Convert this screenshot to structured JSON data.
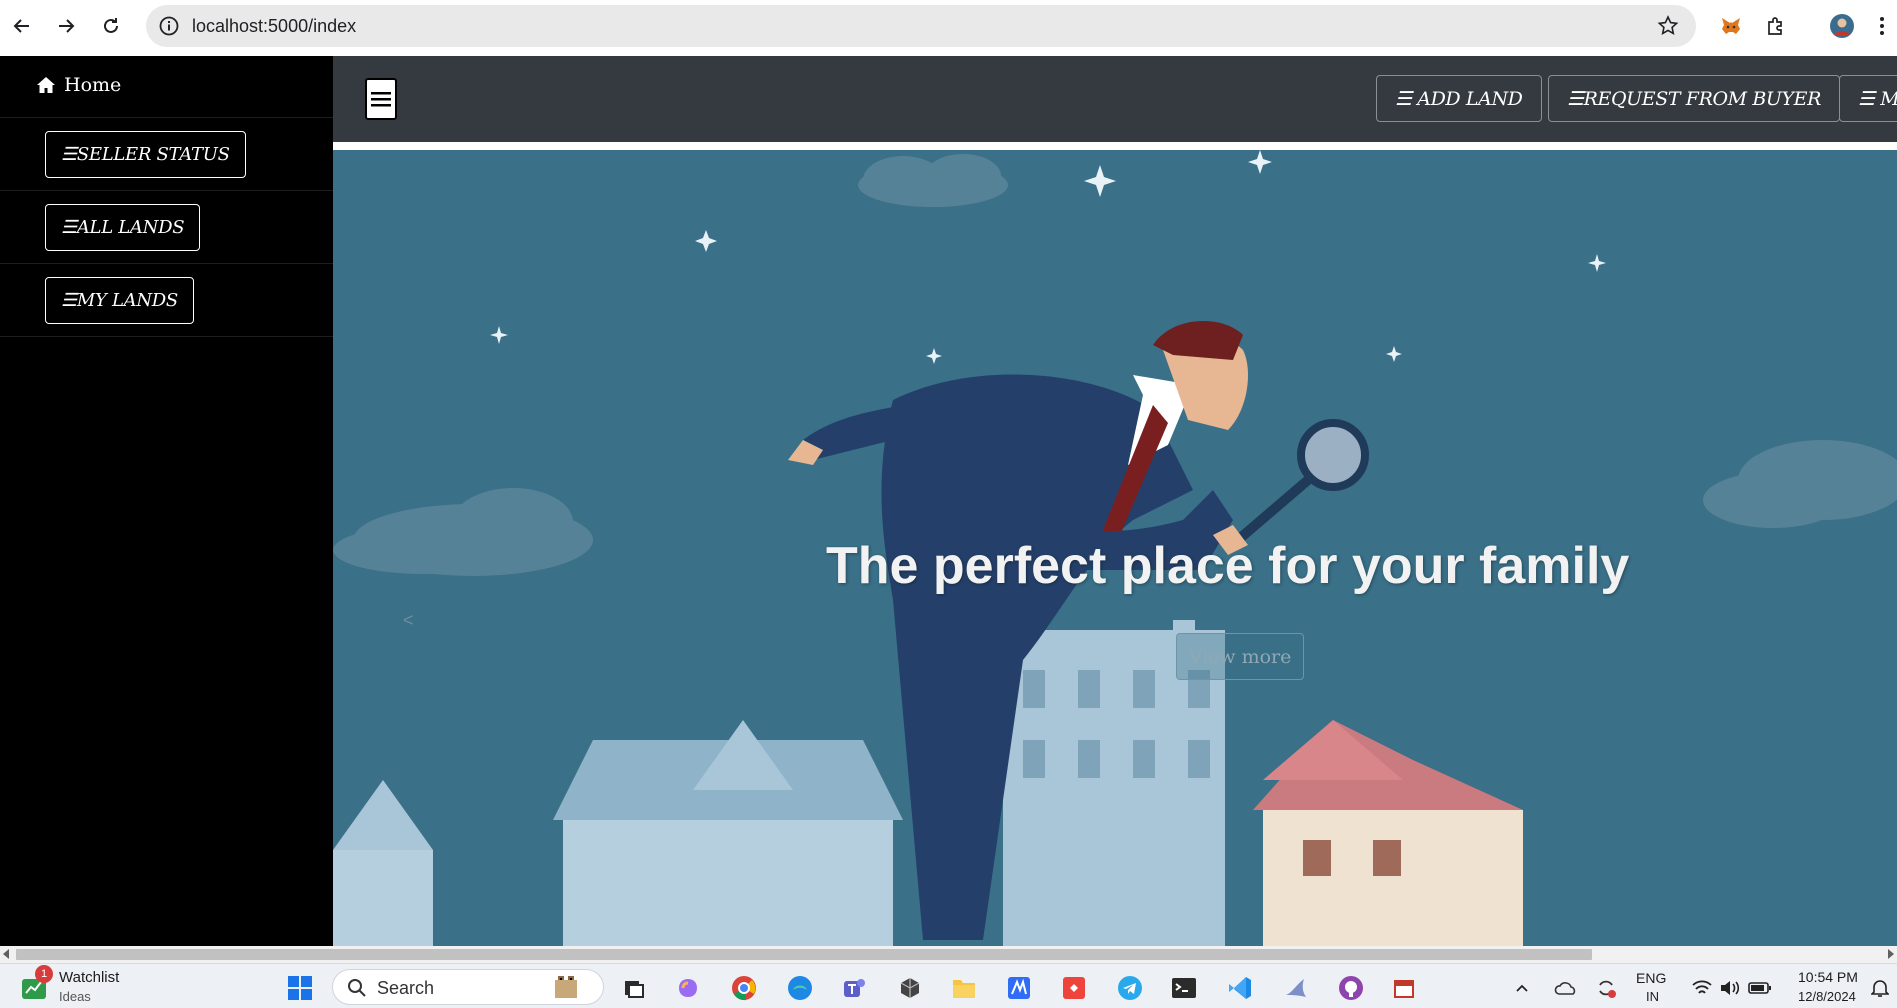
{
  "browser": {
    "url": "localhost:5000/index"
  },
  "sidebar": {
    "home_label": "Home",
    "items": [
      {
        "label": "☰SELLER STATUS"
      },
      {
        "label": "☰ALL LANDS"
      },
      {
        "label": "☰MY LANDS"
      }
    ]
  },
  "topnav": {
    "buttons": [
      {
        "label": "☰ ADD LAND"
      },
      {
        "label": "☰REQUEST FROM BUYER"
      },
      {
        "label": "☰ M"
      }
    ]
  },
  "hero": {
    "title": "The perfect place for your family",
    "button_label": "View more",
    "prev_arrow": "<"
  },
  "taskbar": {
    "widget_title": "Watchlist",
    "widget_subtitle": "Ideas",
    "widget_badge": "1",
    "search_placeholder": "Search",
    "language_top": "ENG",
    "language_bottom": "IN",
    "time": "10:54 PM",
    "date": "12/8/2024"
  },
  "colors": {
    "sidebar_bg": "#000000",
    "topnav_bg": "#343a40",
    "hero_bg": "#3a7088"
  },
  "icons": [
    "back-icon",
    "forward-icon",
    "reload-icon",
    "site-info-icon",
    "star-icon",
    "metamask-icon",
    "extensions-icon",
    "profile-icon",
    "menu-dots-icon",
    "home-icon",
    "hamburger-icon",
    "windows-start-icon",
    "search-icon",
    "wifi-icon",
    "volume-icon",
    "battery-icon",
    "bell-icon"
  ]
}
